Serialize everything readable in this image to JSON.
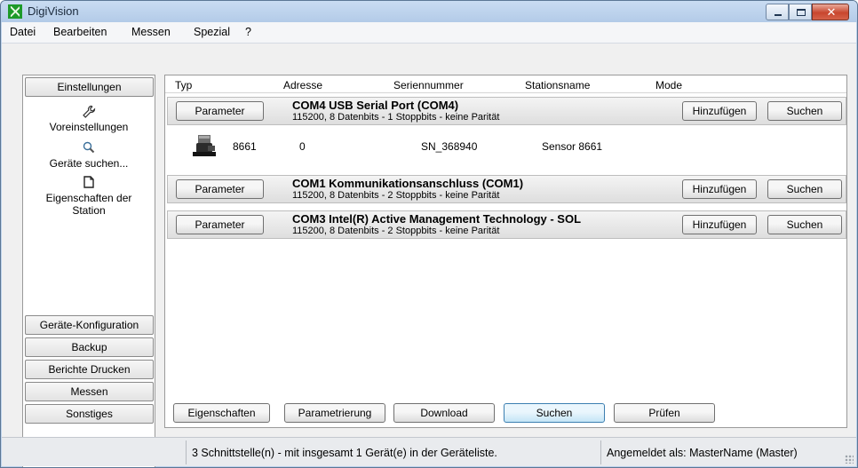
{
  "window": {
    "title": "DigiVision"
  },
  "menu": [
    "Datei",
    "Bearbeiten",
    "Messen",
    "Spezial",
    "?"
  ],
  "sidebar": {
    "top_button": "Einstellungen",
    "items": [
      {
        "label": "Voreinstellungen",
        "icon": "wrench-icon"
      },
      {
        "label": "Geräte suchen...",
        "icon": "magnifier-icon"
      },
      {
        "label_line1": "Eigenschaften der",
        "label_line2": "Station",
        "icon": "station-icon"
      }
    ],
    "bottom_buttons": [
      "Geräte-Konfiguration",
      "Backup",
      "Berichte Drucken",
      "Messen",
      "Sonstiges"
    ]
  },
  "columns": [
    "Typ",
    "Adresse",
    "Seriennummer",
    "Stationsname",
    "Mode"
  ],
  "ports": [
    {
      "name": "COM4 USB Serial Port (COM4)",
      "details": "115200, 8 Datenbits - 1 Stoppbits - keine Parität"
    },
    {
      "name": "COM1 Kommunikationsanschluss (COM1)",
      "details": "115200, 8 Datenbits - 2 Stoppbits - keine Parität"
    },
    {
      "name": "COM3 Intel(R) Active Management Technology - SOL",
      "details": "115200, 8 Datenbits - 2 Stoppbits - keine Parität"
    }
  ],
  "port_buttons": {
    "parameter": "Parameter",
    "add": "Hinzufügen",
    "search": "Suchen"
  },
  "device": {
    "type": "8661",
    "address": "0",
    "serial": "SN_368940",
    "station": "Sensor 8661"
  },
  "footer_buttons": [
    "Eigenschaften",
    "Parametrierung",
    "Download",
    "Suchen",
    "Prüfen"
  ],
  "status": {
    "interfaces": "3 Schnittstelle(n) - mit insgesamt 1 Gerät(e) in der Geräteliste.",
    "login": "Angemeldet als: MasterName (Master)"
  }
}
